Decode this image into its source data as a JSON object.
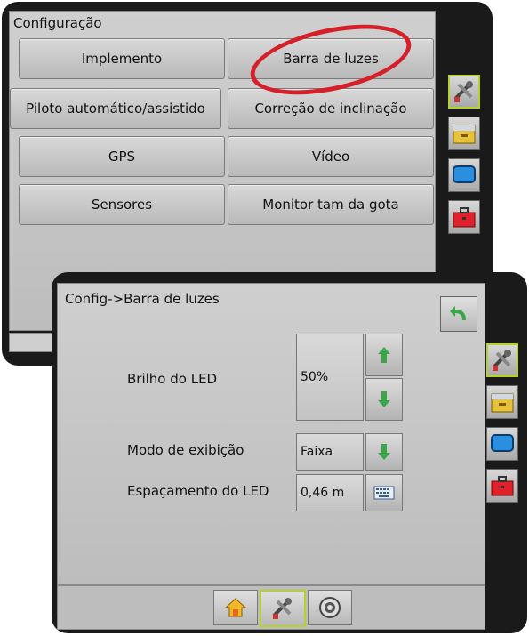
{
  "back_screen": {
    "title": "Configuração",
    "buttons": [
      {
        "label": "Implemento"
      },
      {
        "label": "Barra de luzes"
      },
      {
        "label": "Piloto automático/assistido"
      },
      {
        "label": "Correção de inclinação"
      },
      {
        "label": "GPS"
      },
      {
        "label": "Vídeo"
      },
      {
        "label": "Sensores"
      },
      {
        "label": "Monitor tam da gota"
      }
    ],
    "side_icons": [
      "tools-icon",
      "drawer-icon",
      "monitor-icon",
      "toolbox-icon"
    ],
    "highlight_color": "#d5202a"
  },
  "front_screen": {
    "title": "Config->Barra de luzes",
    "led_brightness": {
      "label": "Brilho do LED",
      "value": "50%"
    },
    "display_mode": {
      "label": "Modo de exibição",
      "value": "Faixa"
    },
    "led_spacing": {
      "label": "Espaçamento do LED",
      "value": "0,46 m"
    },
    "side_icons": [
      "tools-icon",
      "drawer-icon",
      "monitor-icon",
      "toolbox-icon"
    ],
    "bottom_nav": [
      "home-icon",
      "tools-icon",
      "gauge-icon"
    ],
    "accent_color": "#b6d12a"
  }
}
